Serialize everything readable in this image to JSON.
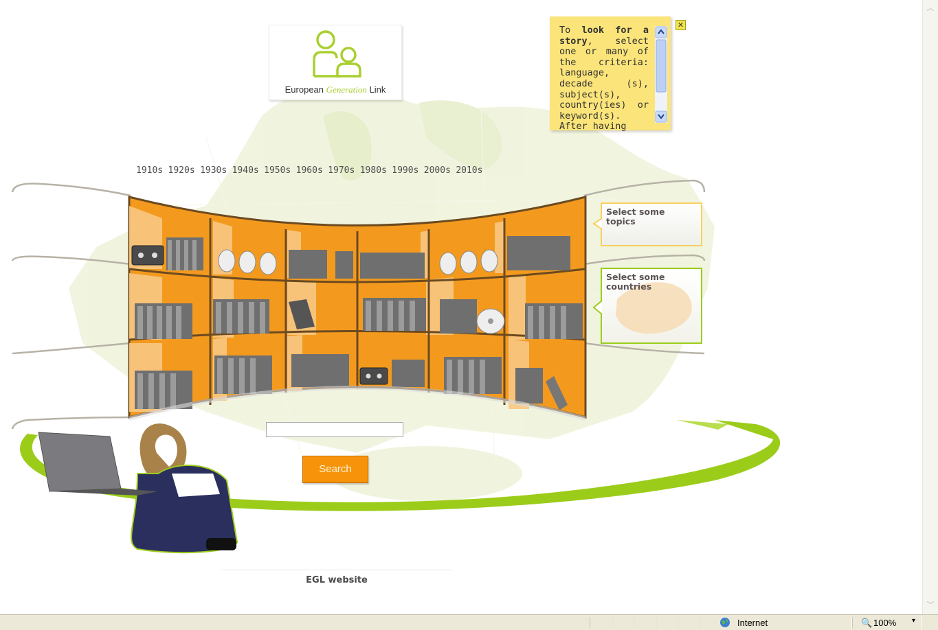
{
  "logo": {
    "part1": "European",
    "part2": "Generation",
    "part3": "Link"
  },
  "decades": [
    "1910s",
    "1920s",
    "1930s",
    "1940s",
    "1950s",
    "1960s",
    "1970s",
    "1980s",
    "1990s",
    "2000s",
    "2010s"
  ],
  "help_note": {
    "text_plain1": "To ",
    "text_bold1": "look for a story",
    "text_plain2": ", select one or many of the criteria: language, decade (s), subject(s), country(ies) or keyword(s). After having",
    "close_label": "✕"
  },
  "callouts": {
    "topics": "Select some topics",
    "countries": "Select some countries"
  },
  "search": {
    "value": "",
    "button_label": "Search"
  },
  "footer": {
    "link_label": "EGL website"
  },
  "statusbar": {
    "zone": "Internet",
    "zoom": "100%"
  },
  "colors": {
    "accent_green": "#9ccc1a",
    "shelf_orange": "#f39a1e",
    "note_yellow": "#fbe47a",
    "search_orange": "#f7930b"
  },
  "icons": [
    "people-logo-icon",
    "cassette-icon",
    "disc-icon",
    "book-icon",
    "globe-icon",
    "zoom-icon",
    "close-icon"
  ]
}
